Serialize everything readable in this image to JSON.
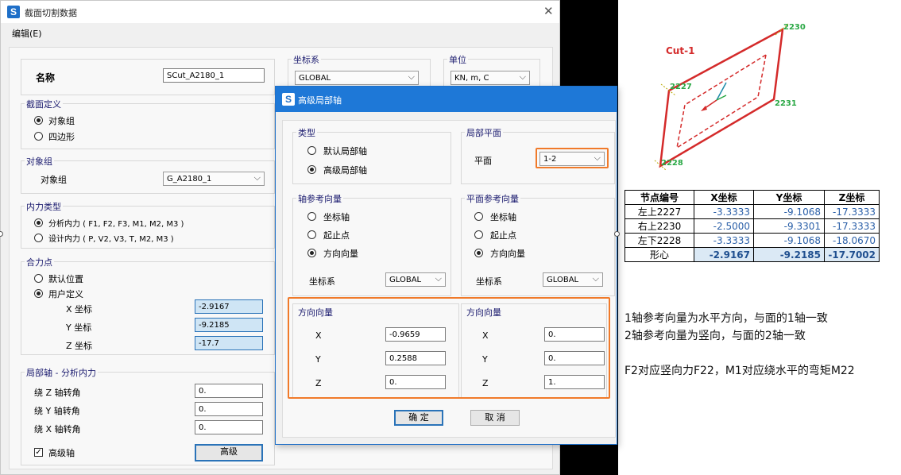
{
  "main_window": {
    "title": "截面切割数据",
    "app_icon": "S",
    "menu": {
      "edit": "编辑(E)"
    },
    "name_label": "名称",
    "name_value": "SCut_A2180_1",
    "coord_label": "坐标系",
    "coord_value": "GLOBAL",
    "unit_label": "单位",
    "unit_value": "KN, m, C",
    "section_def": {
      "title": "截面定义",
      "opt1": "对象组",
      "opt2": "四边形"
    },
    "object_group": {
      "title": "对象组",
      "label": "对象组",
      "value": "G_A2180_1"
    },
    "force_type": {
      "title": "内力类型",
      "opt1": "分析内力 ( F1, F2, F3, M1, M2, M3 )",
      "opt2": "设计内力 ( P, V2, V3, T, M2, M3 )"
    },
    "resultant": {
      "title": "合力点",
      "opt1": "默认位置",
      "opt2": "用户定义",
      "x_label": "X 坐标",
      "x_value": "-2.9167",
      "y_label": "Y 坐标",
      "y_value": "-9.2185",
      "z_label": "Z 坐标",
      "z_value": "-17.7"
    },
    "local_axis": {
      "title": "局部轴 - 分析内力",
      "z_label": "绕 Z 轴转角",
      "z_value": "0.",
      "y_label": "绕 Y 轴转角",
      "y_value": "0.",
      "x_label": "绕 X 轴转角",
      "x_value": "0.",
      "adv_label": "高级轴",
      "adv_button": "高级"
    }
  },
  "dialog": {
    "title": "高级局部轴",
    "app_icon": "S",
    "type": {
      "title": "类型",
      "opt1": "默认局部轴",
      "opt2": "高级局部轴"
    },
    "local_plane": {
      "title": "局部平面",
      "plane_label": "平面",
      "plane_value": "1-2"
    },
    "axis_ref": {
      "title": "轴参考向量",
      "opt1": "坐标轴",
      "opt2": "起止点",
      "opt3": "方向向量",
      "coord_label": "坐标系",
      "coord_value": "GLOBAL"
    },
    "plane_ref": {
      "title": "平面参考向量",
      "opt1": "坐标轴",
      "opt2": "起止点",
      "opt3": "方向向量",
      "coord_label": "坐标系",
      "coord_value": "GLOBAL"
    },
    "dir_left": {
      "title": "方向向量",
      "x_label": "X",
      "x_value": "-0.9659",
      "y_label": "Y",
      "y_value": "0.2588",
      "z_label": "Z",
      "z_value": "0."
    },
    "dir_right": {
      "title": "方向向量",
      "x_label": "X",
      "x_value": "0.",
      "y_label": "Y",
      "y_value": "0.",
      "z_label": "Z",
      "z_value": "1."
    },
    "ok": "确 定",
    "cancel": "取 消"
  },
  "diagram": {
    "cut_label": "Cut-1",
    "nodes": {
      "n2230": "2230",
      "n2227": "2227",
      "n2231": "2231",
      "n2228": "2228"
    }
  },
  "table": {
    "headers": [
      "节点编号",
      "X坐标",
      "Y坐标",
      "Z坐标"
    ],
    "rows": [
      [
        "左上2227",
        "-3.3333",
        "-9.1068",
        "-17.3333"
      ],
      [
        "右上2230",
        "-2.5000",
        "-9.3301",
        "-17.3333"
      ],
      [
        "左下2228",
        "-3.3333",
        "-9.1068",
        "-18.0670"
      ],
      [
        "形心",
        "-2.9167",
        "-9.2185",
        "-17.7002"
      ]
    ]
  },
  "notes": {
    "line1": "1轴参考向量为水平方向，与面的1轴一致",
    "line2": "2轴参考向量为竖向，与面的2轴一致",
    "line3": "F2对应竖向力F22，M1对应绕水平的弯矩M22"
  },
  "colors": {
    "accent_blue": "#1e78d7",
    "highlight_orange": "#f07a2a",
    "diagram_red": "#d42a2a",
    "axis_green": "#2aa845",
    "axis_teal": "#1e8aa8"
  }
}
